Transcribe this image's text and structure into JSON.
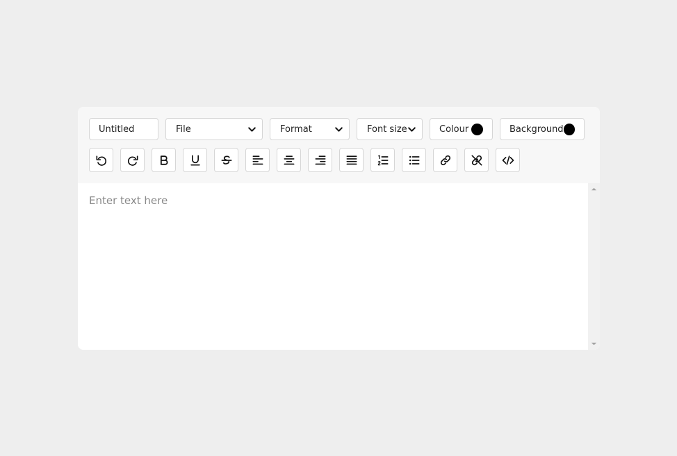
{
  "title_input": {
    "value": "Untitled"
  },
  "file_select": {
    "selected": "File"
  },
  "format_select": {
    "selected": "Format"
  },
  "font_size_select": {
    "selected": "Font size"
  },
  "colour_button": {
    "label": "Colour",
    "color": "#000000"
  },
  "background_button": {
    "label": "Background",
    "color": "#000000"
  },
  "toolbar_icons": [
    "undo-icon",
    "redo-icon",
    "bold-icon",
    "underline-icon",
    "strikethrough-icon",
    "align-left-icon",
    "align-center-icon",
    "align-right-icon",
    "align-justify-icon",
    "ordered-list-icon",
    "unordered-list-icon",
    "link-icon",
    "unlink-icon",
    "code-icon"
  ],
  "content": {
    "placeholder": "Enter text here"
  },
  "colors": {
    "page_background": "#eeeeee",
    "toolbar_background": "#f7f7f7",
    "editor_background": "#ffffff",
    "border": "#d6d6d6",
    "placeholder_text": "#8a8a8a"
  }
}
